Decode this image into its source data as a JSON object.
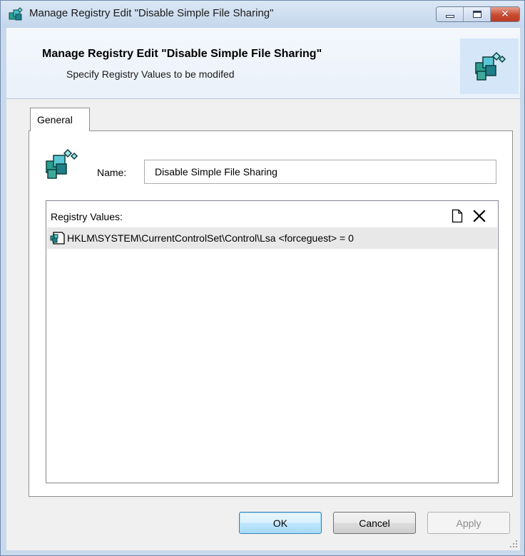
{
  "window": {
    "title": "Manage Registry Edit \"Disable Simple File Sharing\"",
    "icons": [
      "registry-app-icon",
      "minimize-icon",
      "maximize-icon",
      "close-icon"
    ],
    "close_glyph": "✕"
  },
  "header": {
    "title": "Manage Registry Edit \"Disable Simple File Sharing\"",
    "subtitle": "Specify Registry Values to be modifed",
    "icon": "registry-blocks-icon"
  },
  "tabs": [
    {
      "label": "General",
      "selected": true
    }
  ],
  "general": {
    "name_label": "Name:",
    "name_value": "Disable Simple File Sharing",
    "registry_values_label": "Registry Values:",
    "toolbar_icons": [
      "new-document-icon",
      "delete-icon"
    ],
    "registry_values": [
      {
        "text": "HKLM\\SYSTEM\\CurrentControlSet\\Control\\Lsa <forceguest> = 0",
        "icon": "registry-value-icon",
        "selected": true
      }
    ]
  },
  "buttons": {
    "ok": "OK",
    "cancel": "Cancel",
    "apply": "Apply",
    "apply_enabled": false
  },
  "colors": {
    "frame": "#c9d9ec",
    "close_button": "#c74a32",
    "ok_button_border": "#3c7fb1",
    "selected_row": "#e8e8e8",
    "header_icon_bg": "#d4e6f8"
  }
}
